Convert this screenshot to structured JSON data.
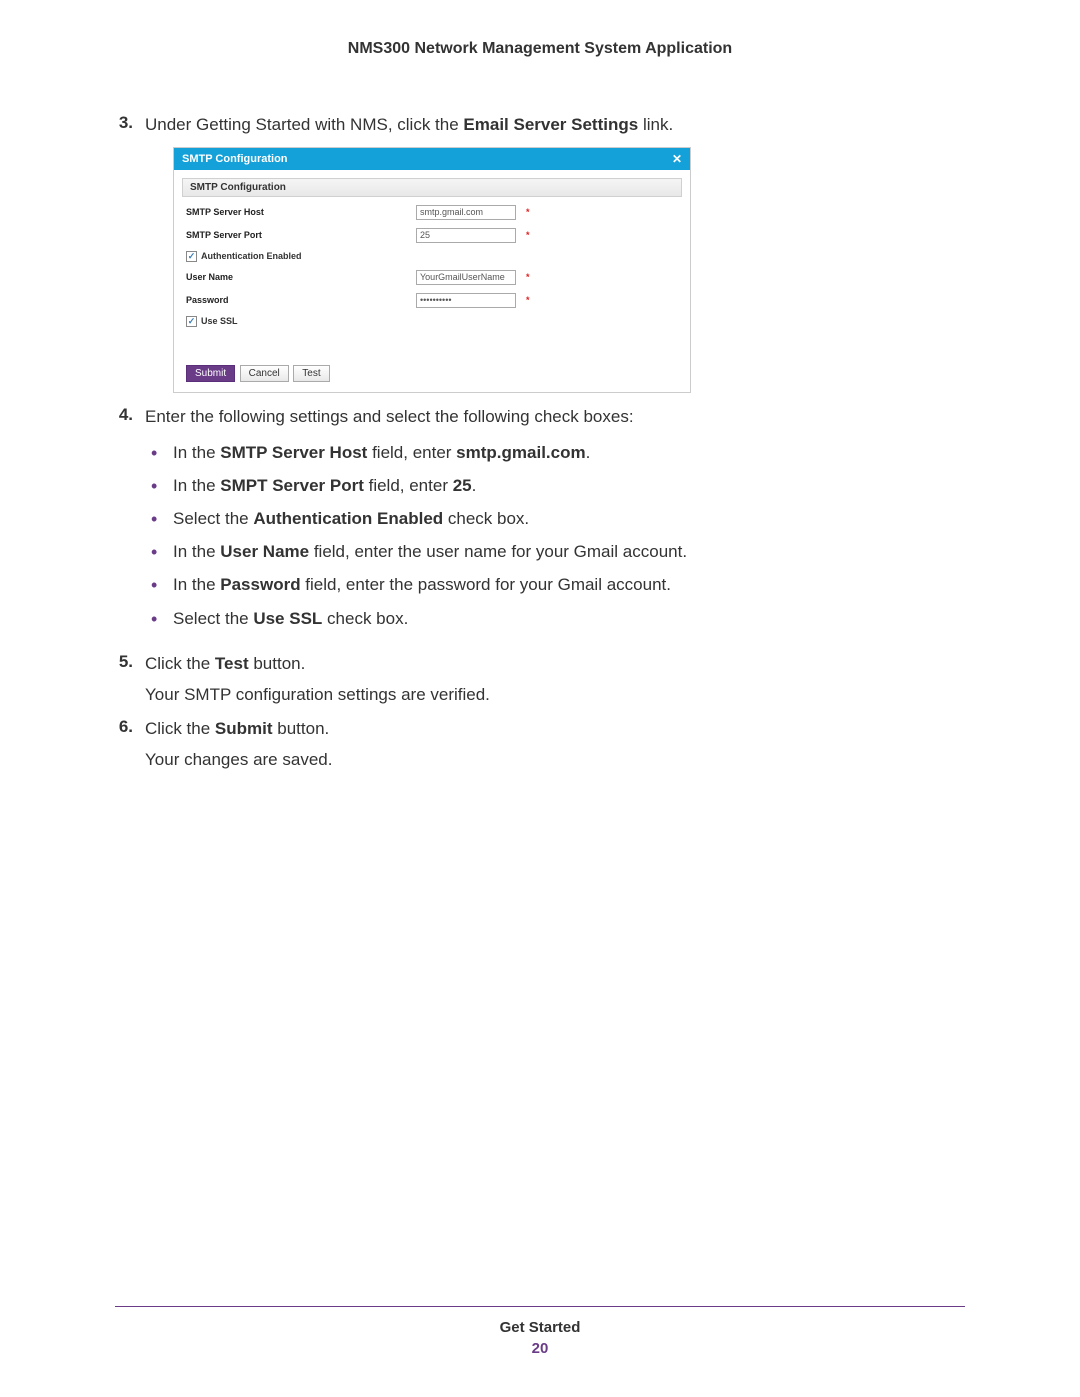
{
  "header": {
    "title": "NMS300 Network Management System Application"
  },
  "dialog": {
    "title": "SMTP Configuration",
    "section": "SMTP Configuration",
    "labels": {
      "host": "SMTP Server Host",
      "port": "SMTP Server Port",
      "auth": "Authentication Enabled",
      "user": "User Name",
      "pass": "Password",
      "ssl": "Use SSL"
    },
    "values": {
      "host": "smtp.gmail.com",
      "port": "25",
      "user": "YourGmailUserName",
      "pass": "••••••••••"
    },
    "buttons": {
      "submit": "Submit",
      "cancel": "Cancel",
      "test": "Test"
    }
  },
  "steps": {
    "s3": {
      "num": "3.",
      "pre": "Under Getting Started with NMS, click the ",
      "link": "Email Server Settings",
      "post": " link."
    },
    "s4": {
      "num": "4.",
      "text": "Enter the following settings and select the following check boxes:",
      "bullets": {
        "b1": {
          "a": "In the ",
          "b": "SMTP Server Host",
          "c": " field, enter ",
          "d": "smtp.gmail.com",
          "e": "."
        },
        "b2": {
          "a": "In the ",
          "b": "SMPT Server Port",
          "c": " field, enter ",
          "d": "25",
          "e": "."
        },
        "b3": {
          "a": "Select the ",
          "b": "Authentication Enabled",
          "c": " check box."
        },
        "b4": {
          "a": "In the ",
          "b": "User Name",
          "c": " field, enter the user name for your Gmail account."
        },
        "b5": {
          "a": "In the ",
          "b": "Password",
          "c": " field, enter the password for your Gmail account."
        },
        "b6": {
          "a": "Select the ",
          "b": "Use SSL",
          "c": " check box."
        }
      }
    },
    "s5": {
      "num": "5.",
      "a": "Click the ",
      "b": "Test",
      "c": " button.",
      "sub": "Your SMTP configuration settings are verified."
    },
    "s6": {
      "num": "6.",
      "a": "Click the ",
      "b": "Submit",
      "c": " button.",
      "sub": "Your changes are saved."
    }
  },
  "footer": {
    "section": "Get Started",
    "page": "20"
  }
}
